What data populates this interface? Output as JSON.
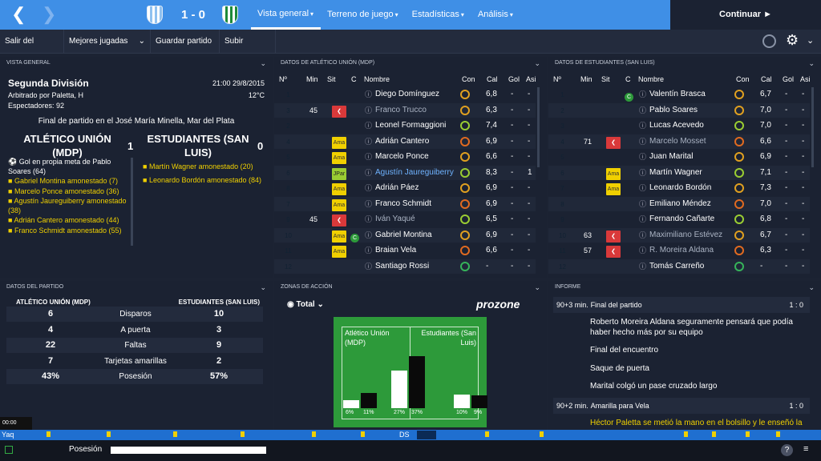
{
  "header": {
    "score": "1 - 0",
    "continue_label": "Continuar",
    "tabs": [
      {
        "label": "Vista general"
      },
      {
        "label": "Terreno de juego"
      },
      {
        "label": "Estadísticas"
      },
      {
        "label": "Análisis"
      }
    ]
  },
  "toolbar": {
    "buttons": [
      "Salir del partido",
      "Mejores jugadas",
      "Guardar partido",
      "Subir jugadas"
    ]
  },
  "overview": {
    "heading": "VISTA GENERAL",
    "league": "Segunda División",
    "datetime": "21:00 29/8/2015",
    "referee": "Arbitrado por Paletta, H",
    "temp": "12°C",
    "spectators": "Espectadores: 92",
    "final_text": "Final de partido en el José María Minella, Mar del Plata",
    "home": "ATLÉTICO UNIÓN (MDP)",
    "home_score": "1",
    "away": "ESTUDIANTES (SAN LUIS)",
    "away_score": "0",
    "home_events": [
      "Gol en propia meta de Pablo Soares (64)",
      "Gabriel Montina amonestado (7)",
      "Marcelo Ponce amonestado (36)",
      "Agustín Jaureguiberry amonestado (38)",
      "Adrián Cantero amonestado (44)",
      "Franco Schmidt amonestado (55)"
    ],
    "away_events": [
      "Martín Wagner amonestado (20)",
      "Leonardo Bordón amonestado (84)"
    ]
  },
  "home_table": {
    "heading": "DATOS DE ATLÉTICO UNIÓN (MDP)",
    "cols": [
      "Nº",
      "Min",
      "Sit",
      "C",
      "Nombre",
      "Con",
      "Cal",
      "Gol",
      "Asi"
    ],
    "rows": [
      [
        "1",
        "",
        "",
        "",
        "Diego Domínguez",
        "6,8",
        "-",
        "-"
      ],
      [
        "3",
        "45",
        "red",
        "",
        "Franco Trucco",
        "6,3",
        "-",
        "-"
      ],
      [
        "2",
        "",
        "",
        "",
        "Leonel Formaggioni",
        "7,4",
        "-",
        "-"
      ],
      [
        "4",
        "",
        "Ama",
        "",
        "Adrián Cantero",
        "6,9",
        "-",
        "-"
      ],
      [
        "5",
        "",
        "Ama",
        "",
        "Marcelo Ponce",
        "6,6",
        "-",
        "-"
      ],
      [
        "6",
        "",
        "JPar",
        "",
        "Agustín Jaureguiberry",
        "8,3",
        "-",
        "1"
      ],
      [
        "8",
        "",
        "Ama",
        "",
        "Adrián Páez",
        "6,9",
        "-",
        "-"
      ],
      [
        "7",
        "",
        "Ama",
        "",
        "Franco Schmidt",
        "6,9",
        "-",
        "-"
      ],
      [
        "9",
        "45",
        "red",
        "",
        "Iván Yaqué",
        "6,5",
        "-",
        "-"
      ],
      [
        "10",
        "",
        "Ama",
        "C",
        "Gabriel Montina",
        "6,9",
        "-",
        "-"
      ],
      [
        "11",
        "",
        "Ama",
        "",
        "Braian Vela",
        "6,6",
        "-",
        "-"
      ],
      [
        "12",
        "",
        "",
        "",
        "Santiago Rossi",
        "-",
        "-",
        "-"
      ]
    ]
  },
  "away_table": {
    "heading": "DATOS DE ESTUDIANTES (SAN LUIS)",
    "cols": [
      "Nº",
      "Min",
      "Sit",
      "C",
      "Nombre",
      "Con",
      "Cal",
      "Gol",
      "Asi"
    ],
    "rows": [
      [
        "1",
        "",
        "",
        "C",
        "Valentín Brasca",
        "6,7",
        "-",
        "-"
      ],
      [
        "2",
        "",
        "",
        "",
        "Pablo Soares",
        "7,0",
        "-",
        "-"
      ],
      [
        "3",
        "",
        "",
        "",
        "Lucas Acevedo",
        "7,0",
        "-",
        "-"
      ],
      [
        "4",
        "71",
        "red",
        "",
        "Marcelo Mosset",
        "6,6",
        "-",
        "-"
      ],
      [
        "5",
        "",
        "",
        "",
        "Juan Marital",
        "6,9",
        "-",
        "-"
      ],
      [
        "6",
        "",
        "Ama",
        "",
        "Martín Wagner",
        "7,1",
        "-",
        "-"
      ],
      [
        "7",
        "",
        "Ama",
        "",
        "Leonardo Bordón",
        "7,3",
        "-",
        "-"
      ],
      [
        "8",
        "",
        "",
        "",
        "Emiliano Méndez",
        "7,0",
        "-",
        "-"
      ],
      [
        "9",
        "",
        "",
        "",
        "Fernando Cañarte",
        "6,8",
        "-",
        "-"
      ],
      [
        "10",
        "63",
        "red",
        "",
        "Maximiliano Estévez",
        "6,7",
        "-",
        "-"
      ],
      [
        "11",
        "57",
        "red",
        "",
        "R. Moreira Aldana",
        "6,3",
        "-",
        "-"
      ],
      [
        "12",
        "",
        "",
        "",
        "Tomás Carreño",
        "-",
        "-",
        "-"
      ]
    ]
  },
  "match_data": {
    "heading": "DATOS DEL PARTIDO",
    "home": "ATLÉTICO UNIÓN (MDP)",
    "away": "ESTUDIANTES (SAN LUIS)",
    "rows": [
      [
        "6",
        "Disparos",
        "10"
      ],
      [
        "4",
        "A puerta",
        "3"
      ],
      [
        "22",
        "Faltas",
        "9"
      ],
      [
        "7",
        "Tarjetas amarillas",
        "2"
      ],
      [
        "43%",
        "Posesión",
        "57%"
      ]
    ]
  },
  "zones": {
    "heading": "ZONAS DE ACCIÓN",
    "filter": "Total",
    "brand": "prozone",
    "home": "Atlético Unión (MDP)",
    "away": "Estudiantes (San Luis)",
    "bars": [
      [
        "6%",
        "11%"
      ],
      [
        "27%",
        "37%"
      ],
      [
        "10%",
        "9%"
      ]
    ]
  },
  "report": {
    "heading": "INFORME",
    "entries": [
      {
        "min": "90+3 min.",
        "title": "Final del partido",
        "score": "1 : 0"
      },
      {
        "text": "Roberto Moreira Aldana seguramente pensará que podía haber hecho más por su equipo"
      },
      {
        "text": "Final del encuentro"
      },
      {
        "text": "Saque de puerta"
      },
      {
        "text": "Marital colgó un pase cruzado largo"
      },
      {
        "min": "90+2 min.",
        "title": "Amarilla para Vela",
        "score": "1 : 0"
      },
      {
        "text": "Héctor Paletta se metió la mano en el bolsillo y le enseñó la"
      }
    ]
  },
  "timeline": {
    "left": "Yaq",
    "mid": "DS",
    "clock": "00:00"
  },
  "footer": {
    "label": "Posesión"
  }
}
